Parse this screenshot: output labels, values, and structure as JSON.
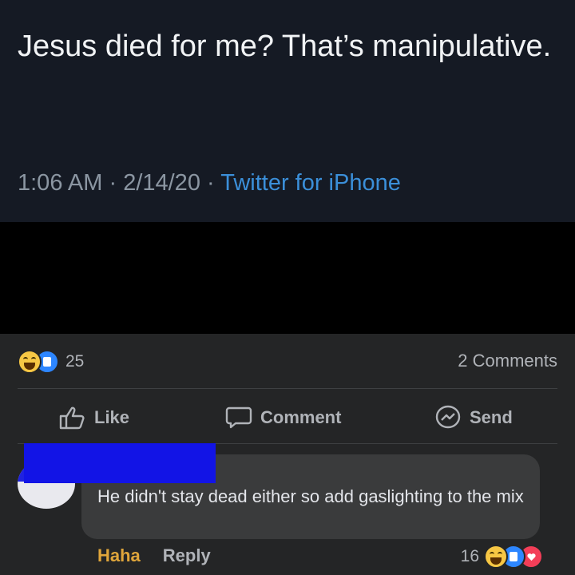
{
  "tweet": {
    "text": "Jesus died for me? That’s manipulative.",
    "time": "1:06 AM",
    "date": "2/14/20",
    "source": "Twitter for iPhone",
    "separator": " · "
  },
  "post": {
    "reaction_count": "25",
    "reaction_icons": [
      "haha-icon",
      "like-icon"
    ],
    "comments_count": "2 Comments",
    "actions": {
      "like": "Like",
      "comment": "Comment",
      "send": "Send"
    }
  },
  "comment": {
    "text": "He didn't stay dead either so add gaslighting to the mix",
    "haha_label": "Haha",
    "reply_label": "Reply",
    "reaction_count": "16",
    "reaction_icons": [
      "haha-icon",
      "like-icon",
      "love-icon"
    ]
  },
  "colors": {
    "tweet_bg": "#151a24",
    "fb_bg": "#242526",
    "link_blue": "#3b8fd9",
    "haha_orange": "#e0a63b",
    "redaction_blue": "#1214e6"
  }
}
